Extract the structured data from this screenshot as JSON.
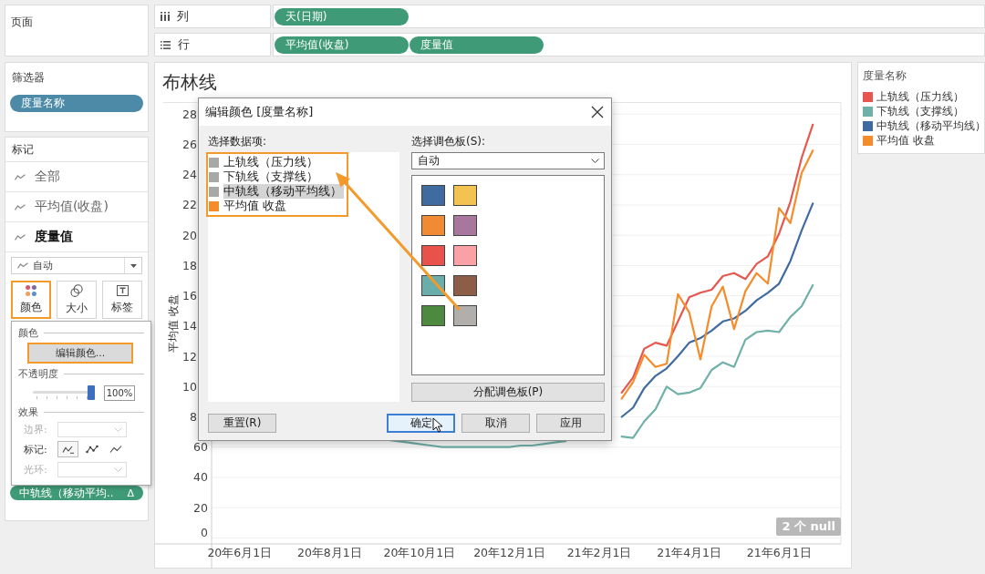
{
  "shelves": [
    {
      "kind": "columns",
      "label": "列",
      "pills": [
        {
          "label": "天(日期)"
        }
      ]
    },
    {
      "kind": "rows",
      "label": "行",
      "pills": [
        {
          "label": "平均值(收盘)"
        },
        {
          "label": "度量值"
        }
      ]
    }
  ],
  "sidebar": {
    "pages": {
      "title": "页面"
    },
    "filters": {
      "title": "筛选器",
      "pills": [
        {
          "label": "度量名称"
        }
      ]
    },
    "marks": {
      "title": "标记",
      "tabs": [
        {
          "label": "全部",
          "selected": false
        },
        {
          "label": "平均值(收盘)",
          "selected": false
        },
        {
          "label": "度量值",
          "selected": true
        }
      ],
      "mark_type": "自动",
      "buttons": [
        {
          "kind": "color",
          "label": "颜色",
          "highlighted": true
        },
        {
          "kind": "size",
          "label": "大小",
          "highlighted": false
        },
        {
          "kind": "label",
          "label": "标签",
          "highlighted": false
        }
      ],
      "pills": [
        {
          "label": "中轨线（移动平均..",
          "calc_mark": "Δ"
        }
      ]
    }
  },
  "color_popup": {
    "color_heading": "颜色",
    "edit_button": {
      "label": "编辑颜色...",
      "highlighted": true
    },
    "opacity_heading": "不透明度",
    "opacity": {
      "level": 1,
      "reading": "100%"
    },
    "effects_heading": "效果",
    "effects": [
      {
        "kind": "dropdown",
        "label": "边界:",
        "disabled": true
      },
      {
        "kind": "markers",
        "label": "标记:",
        "disabled": false,
        "options": [
          {
            "kind": "endpoint",
            "selected": true
          },
          {
            "kind": "dotted",
            "selected": false
          },
          {
            "kind": "plain",
            "selected": false
          }
        ]
      },
      {
        "kind": "dropdown",
        "label": "光环:",
        "disabled": true
      }
    ]
  },
  "chart": {
    "null_badge": "2 个 null",
    "y_tick_labels_cut_off": [
      "28",
      "26",
      "24",
      "22",
      "20",
      "18",
      "16",
      "14",
      "12",
      "10",
      "8"
    ],
    "chart_data": {
      "type": "line",
      "title": "布林线",
      "ylabel": "平均值 收盘",
      "grid": true,
      "legend": "right",
      "categories": [
        null,
        null,
        "20年6月1日",
        null,
        null,
        null,
        null,
        null,
        null,
        null,
        "20年8月1日",
        null,
        null,
        null,
        null,
        null,
        null,
        null,
        "20年10月1日",
        null,
        null,
        null,
        null,
        null,
        null,
        null,
        "20年12月1日",
        null,
        null,
        null,
        null,
        null,
        null,
        null,
        "21年2月1日",
        null,
        null,
        null,
        null,
        null,
        null,
        null,
        "21年4月1日",
        null,
        null,
        null,
        null,
        null,
        null,
        null,
        "21年6月1日",
        null,
        null,
        null,
        null,
        null
      ],
      "ylim": [
        -4,
        288
      ],
      "yticks": [
        60,
        40,
        20,
        0
      ],
      "series": [
        {
          "name": "上轨线（压力线）",
          "color": "#e5574f",
          "values": [
            null,
            null,
            null,
            null,
            null,
            null,
            null,
            null,
            null,
            null,
            null,
            null,
            null,
            null,
            null,
            null,
            null,
            null,
            null,
            null,
            null,
            null,
            null,
            null,
            null,
            null,
            null,
            null,
            null,
            null,
            null,
            null,
            null,
            null,
            null,
            null,
            96,
            106,
            125,
            129,
            127,
            143,
            159,
            162,
            164,
            173,
            175,
            171,
            181,
            186,
            201,
            222,
            251,
            273,
            null,
            null
          ]
        },
        {
          "name": "下轨线（支撑线）",
          "color": "#6fb0a8",
          "values": [
            null,
            null,
            null,
            null,
            null,
            null,
            null,
            null,
            null,
            null,
            null,
            null,
            null,
            null,
            null,
            65,
            64,
            63,
            62,
            61,
            60,
            60,
            60,
            60,
            60,
            60,
            60,
            61,
            61,
            62,
            63,
            64,
            null,
            null,
            null,
            null,
            67,
            66,
            77,
            85,
            100,
            95,
            96,
            99,
            111,
            116,
            113,
            131,
            136,
            137,
            136,
            146,
            153,
            167,
            null,
            null
          ]
        },
        {
          "name": "中轨线（移动平均线）",
          "color": "#3f6ba1",
          "values": [
            null,
            null,
            null,
            null,
            null,
            null,
            null,
            null,
            null,
            null,
            null,
            null,
            null,
            null,
            null,
            null,
            null,
            null,
            null,
            null,
            null,
            null,
            null,
            null,
            null,
            null,
            null,
            null,
            null,
            null,
            null,
            null,
            null,
            null,
            null,
            null,
            80,
            86,
            99,
            107,
            112,
            120,
            129,
            132,
            137,
            143,
            145,
            150,
            157,
            162,
            168,
            183,
            203,
            221,
            null,
            null
          ]
        },
        {
          "name": "平均值 收盘",
          "color": "#f48c2c",
          "values": [
            null,
            null,
            null,
            null,
            null,
            null,
            null,
            null,
            null,
            null,
            null,
            null,
            null,
            null,
            null,
            null,
            null,
            null,
            null,
            null,
            null,
            null,
            null,
            null,
            null,
            null,
            null,
            null,
            null,
            null,
            null,
            null,
            null,
            null,
            null,
            null,
            92,
            103,
            121,
            113,
            115,
            161,
            149,
            118,
            153,
            166,
            138,
            163,
            175,
            168,
            218,
            208,
            241,
            256,
            null,
            null
          ]
        }
      ]
    }
  },
  "legend": {
    "title": "度量名称"
  },
  "dialog": {
    "title": "编辑颜色 [度量名称]",
    "data_items_label": "选择数据项:",
    "data_items_highlighted": true,
    "data_items": [
      {
        "label": "上轨线（压力线）",
        "color": "#aaa8a7",
        "selected": false
      },
      {
        "label": "下轨线（支撑线）",
        "color": "#aaa8a7",
        "selected": false
      },
      {
        "label": "中轨线（移动平均线）",
        "color": "#aaa8a7",
        "selected": true
      },
      {
        "label": "平均值 收盘",
        "color": "#f48c2c",
        "selected": false
      }
    ],
    "palette_label": "选择调色板(S):",
    "palette_value": "自动",
    "swatches": [
      {
        "color": "#3f6ba1"
      },
      {
        "color": "#f2c350"
      },
      {
        "color": "#f08a33"
      },
      {
        "color": "#a8779d"
      },
      {
        "color": "#e8524b"
      },
      {
        "color": "#f9a1a6"
      },
      {
        "color": "#6aaeab"
      },
      {
        "color": "#8c5d47"
      },
      {
        "color": "#4d8a3f"
      },
      {
        "color": "#b2aeab"
      }
    ],
    "assign_button": "分配调色板(P)",
    "buttons": [
      {
        "kind": "reset",
        "label": "重置(R)",
        "focused": false
      },
      {
        "kind": "ok",
        "label": "确定",
        "focused": true
      },
      {
        "kind": "cancel",
        "label": "取消",
        "focused": false
      },
      {
        "kind": "apply",
        "label": "应用",
        "focused": false
      }
    ]
  }
}
